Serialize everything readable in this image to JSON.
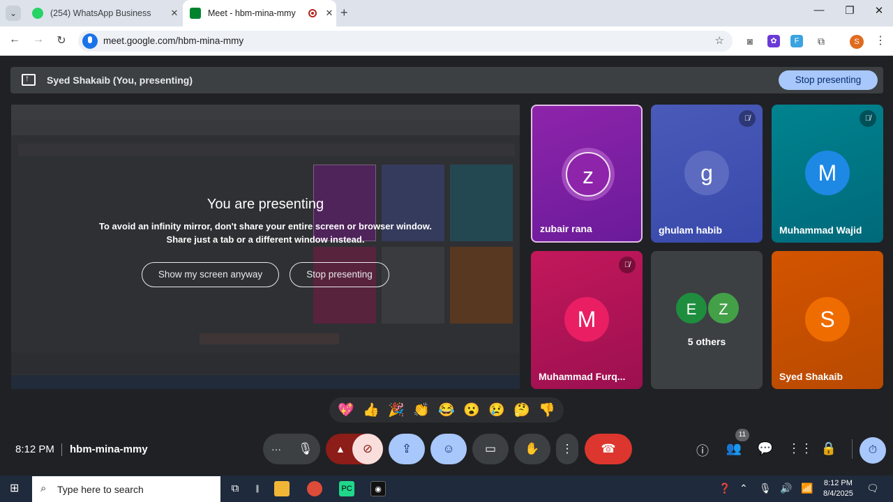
{
  "browser": {
    "tabs": [
      {
        "title": "(254) WhatsApp Business",
        "active": false
      },
      {
        "title": "Meet - hbm-mina-mmy",
        "active": true
      }
    ],
    "url": "meet.google.com/hbm-mina-mmy"
  },
  "presenting_bar": {
    "presenter": "Syed Shakaib (You, presenting)",
    "stop_label": "Stop presenting"
  },
  "shared_screen": {
    "title": "You are presenting",
    "line1": "To avoid an infinity mirror, don't share your entire screen or browser window.",
    "line2": "Share just a tab or a different window instead.",
    "show_button": "Show my screen anyway",
    "stop_button": "Stop presenting"
  },
  "participants": [
    {
      "name": "zubair rana",
      "initial": "z",
      "color": "#7b1fa2",
      "avatar": "#8e24aa",
      "muted": false,
      "speaking": true
    },
    {
      "name": "ghulam habib",
      "initial": "g",
      "color": "#3f51b5",
      "avatar": "#5c6bc0",
      "muted": true,
      "speaking": false
    },
    {
      "name": "Muhammad Wajid",
      "initial": "M",
      "color": "#00838f",
      "avatar": "#1e88e5",
      "muted": true,
      "speaking": false
    },
    {
      "name": "Muhammad Furq...",
      "initial": "M",
      "color": "#ad1457",
      "avatar": "#e91e63",
      "muted": true,
      "speaking": false
    },
    {
      "name": "Syed Shakaib",
      "initial": "S",
      "color": "#d35400",
      "avatar": "#ef6c00",
      "muted": false,
      "speaking": false
    }
  ],
  "others": {
    "label": "5 others",
    "initials": [
      "E",
      "Z"
    ],
    "colors": [
      "#1e8e3e",
      "#43a047"
    ]
  },
  "reactions": [
    "💖",
    "👍",
    "🎉",
    "👏",
    "😂",
    "😮",
    "😢",
    "🤔",
    "👎"
  ],
  "bottom_bar": {
    "time": "8:12 PM",
    "meeting_code": "hbm-mina-mmy",
    "people_count": "11"
  },
  "taskbar": {
    "search_placeholder": "Type here to search",
    "time": "8:12 PM",
    "date": "8/4/2025"
  }
}
